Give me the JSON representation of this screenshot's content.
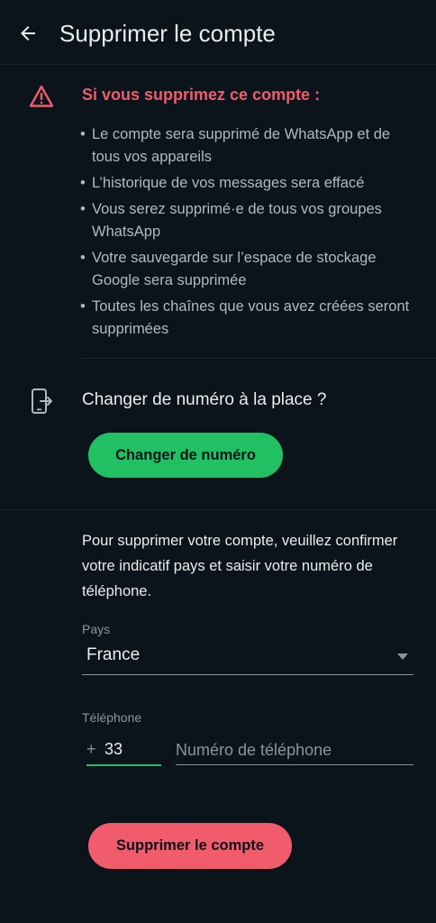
{
  "header": {
    "title": "Supprimer le compte",
    "back_icon": "arrow-left-icon"
  },
  "warning": {
    "icon": "warning-triangle-icon",
    "title": "Si vous supprimez ce compte :",
    "bullets": [
      "Le compte sera supprimé de WhatsApp et de tous vos appareils",
      "L’historique de vos messages sera effacé",
      "Vous serez supprimé·e de tous vos groupes WhatsApp",
      "Votre sauvegarde sur l’espace de stockage Google sera supprimée",
      "Toutes les chaînes que vous avez créées seront supprimées"
    ]
  },
  "change_number": {
    "icon": "phone-exit-icon",
    "title": "Changer de numéro à la place ?",
    "button_label": "Changer de numéro"
  },
  "form": {
    "instructions": "Pour supprimer votre compte, veuillez confirmer votre indicatif pays et saisir votre numéro de téléphone.",
    "country_label": "Pays",
    "country_value": "France",
    "phone_label": "Téléphone",
    "country_code_prefix": "+",
    "country_code": "33",
    "phone_placeholder": "Numéro de téléphone",
    "phone_value": ""
  },
  "delete_button_label": "Supprimer le compte",
  "colors": {
    "background": "#0b141a",
    "accent_green": "#21c063",
    "danger_red": "#f15c6d",
    "text_primary": "#e9edef",
    "text_secondary": "#8696a0"
  }
}
